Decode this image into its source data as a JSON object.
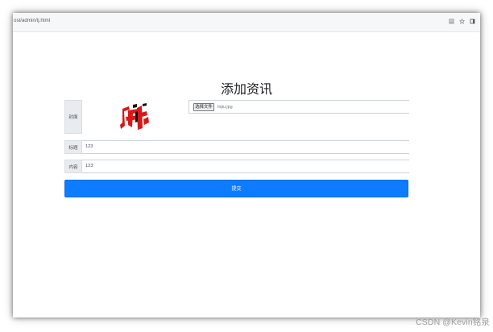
{
  "browser": {
    "address": "ost/admin/tj.html",
    "icons": [
      "bookmark-list-icon",
      "star-icon",
      "window-icon"
    ]
  },
  "form": {
    "title": "添加资讯",
    "cover_label": "封面",
    "file_button_label": "选择文件",
    "file_name": "tiqiu.jpg",
    "title_label": "标题",
    "title_value": "123",
    "content_label": "内容",
    "content_value": "123",
    "submit_label": "提交"
  },
  "watermark": {
    "text": "CSDN @Kevin铭泉"
  },
  "colors": {
    "primary": "#0d7cff",
    "cover_red": "#d81818",
    "cover_black": "#111111"
  }
}
